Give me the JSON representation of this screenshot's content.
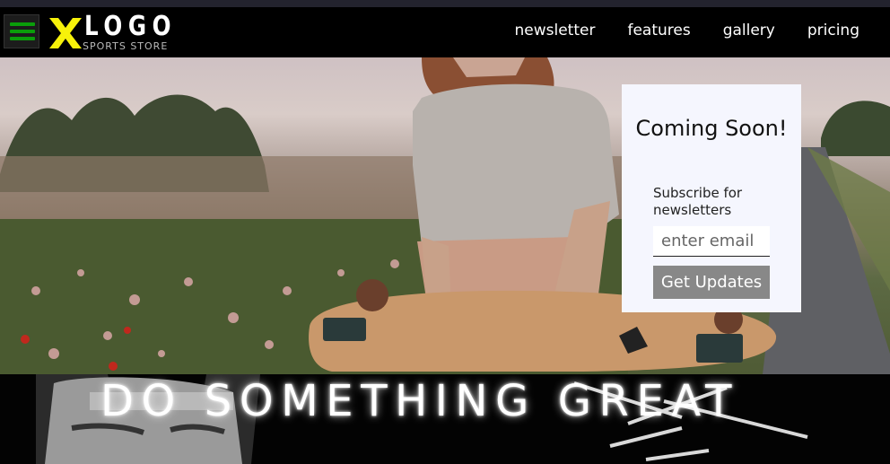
{
  "app": {
    "logo_text": "LOGO",
    "logo_subtitle": "SPORTS STORE",
    "logo_color": "#f7f20a",
    "menu_icon_color": "#0a9e0a"
  },
  "nav": {
    "items": [
      {
        "label": "newsletter"
      },
      {
        "label": "features"
      },
      {
        "label": "gallery"
      },
      {
        "label": "pricing"
      }
    ]
  },
  "subscribe": {
    "title": "Coming Soon!",
    "description": "Subscribe for newsletters",
    "email_placeholder": "enter email",
    "button_label": "Get Updates"
  },
  "banner": {
    "headline": "DO SOMETHING GREAT"
  }
}
